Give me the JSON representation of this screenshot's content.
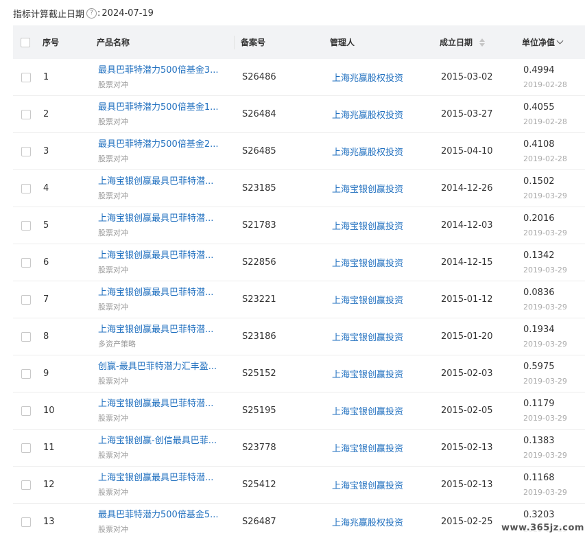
{
  "topline": {
    "label": "指标计算截止日期",
    "help": "?",
    "colon": ":",
    "date": "2024-07-19"
  },
  "headers": {
    "index": "序号",
    "product": "产品名称",
    "record": "备案号",
    "manager": "管理人",
    "established": "成立日期",
    "nav": "单位净值"
  },
  "rows": [
    {
      "idx": "1",
      "name": "最具巴菲特潜力500倍基金3...",
      "type": "股票对冲",
      "record": "S26486",
      "manager": "上海兆赢股权投资",
      "date": "2015-03-02",
      "nav": "0.4994",
      "nav_date": "2019-02-28"
    },
    {
      "idx": "2",
      "name": "最具巴菲特潜力500倍基金1...",
      "type": "股票对冲",
      "record": "S26484",
      "manager": "上海兆赢股权投资",
      "date": "2015-03-27",
      "nav": "0.4055",
      "nav_date": "2019-02-28"
    },
    {
      "idx": "3",
      "name": "最具巴菲特潜力500倍基金2...",
      "type": "股票对冲",
      "record": "S26485",
      "manager": "上海兆赢股权投资",
      "date": "2015-04-10",
      "nav": "0.4108",
      "nav_date": "2019-02-28"
    },
    {
      "idx": "4",
      "name": "上海宝银创赢最具巴菲特潜...",
      "type": "股票对冲",
      "record": "S23185",
      "manager": "上海宝银创赢投资",
      "date": "2014-12-26",
      "nav": "0.1502",
      "nav_date": "2019-03-29"
    },
    {
      "idx": "5",
      "name": "上海宝银创赢最具巴菲特潜...",
      "type": "股票对冲",
      "record": "S21783",
      "manager": "上海宝银创赢投资",
      "date": "2014-12-03",
      "nav": "0.2016",
      "nav_date": "2019-03-29"
    },
    {
      "idx": "6",
      "name": "上海宝银创赢最具巴菲特潜...",
      "type": "股票对冲",
      "record": "S22856",
      "manager": "上海宝银创赢投资",
      "date": "2014-12-15",
      "nav": "0.1342",
      "nav_date": "2019-03-29"
    },
    {
      "idx": "7",
      "name": "上海宝银创赢最具巴菲特潜...",
      "type": "股票对冲",
      "record": "S23221",
      "manager": "上海宝银创赢投资",
      "date": "2015-01-12",
      "nav": "0.0836",
      "nav_date": "2019-03-29"
    },
    {
      "idx": "8",
      "name": "上海宝银创赢最具巴菲特潜...",
      "type": "多资产策略",
      "record": "S23186",
      "manager": "上海宝银创赢投资",
      "date": "2015-01-20",
      "nav": "0.1934",
      "nav_date": "2019-03-29"
    },
    {
      "idx": "9",
      "name": "创赢-最具巴菲特潜力汇丰盈...",
      "type": "股票对冲",
      "record": "S25152",
      "manager": "上海宝银创赢投资",
      "date": "2015-02-03",
      "nav": "0.5975",
      "nav_date": "2019-03-29"
    },
    {
      "idx": "10",
      "name": "上海宝银创赢最具巴菲特潜...",
      "type": "股票对冲",
      "record": "S25195",
      "manager": "上海宝银创赢投资",
      "date": "2015-02-05",
      "nav": "0.1179",
      "nav_date": "2019-03-29"
    },
    {
      "idx": "11",
      "name": "上海宝银创赢-创信最具巴菲...",
      "type": "股票对冲",
      "record": "S23778",
      "manager": "上海宝银创赢投资",
      "date": "2015-02-13",
      "nav": "0.1383",
      "nav_date": "2019-03-29"
    },
    {
      "idx": "12",
      "name": "上海宝银创赢最具巴菲特潜...",
      "type": "股票对冲",
      "record": "S25412",
      "manager": "上海宝银创赢投资",
      "date": "2015-02-13",
      "nav": "0.1168",
      "nav_date": "2019-03-29"
    },
    {
      "idx": "13",
      "name": "最具巴菲特潜力500倍基金5...",
      "type": "股票对冲",
      "record": "S26487",
      "manager": "上海兆赢股权投资",
      "date": "2015-02-25",
      "nav": "0.3203",
      "nav_date": "2019-03-29"
    }
  ],
  "watermark": "www.365jz.com",
  "colors": {
    "link": "#1f6fbf",
    "header_bg": "#f2f3f5",
    "muted": "#999999"
  }
}
